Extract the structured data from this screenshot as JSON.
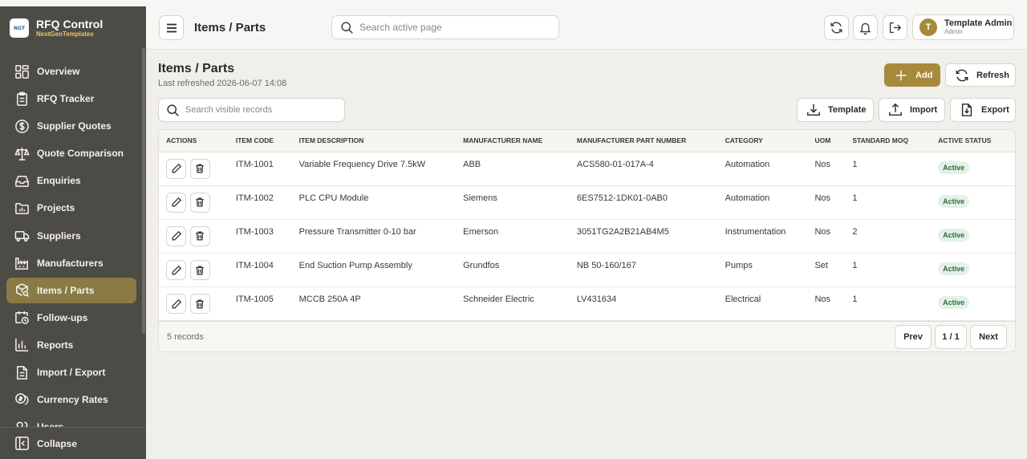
{
  "brand": {
    "title": "RFQ Control",
    "subtitle": "NextGenTemplates",
    "logo_text": "NGT"
  },
  "sidebar": {
    "items": [
      {
        "label": "Overview",
        "icon": "grid-icon"
      },
      {
        "label": "RFQ Tracker",
        "icon": "clipboard-icon"
      },
      {
        "label": "Supplier Quotes",
        "icon": "dollar-circle-icon"
      },
      {
        "label": "Quote Comparison",
        "icon": "scale-icon"
      },
      {
        "label": "Enquiries",
        "icon": "inbox-icon"
      },
      {
        "label": "Projects",
        "icon": "folder-chart-icon"
      },
      {
        "label": "Suppliers",
        "icon": "truck-icon"
      },
      {
        "label": "Manufacturers",
        "icon": "factory-icon"
      },
      {
        "label": "Items / Parts",
        "icon": "box-search-icon",
        "active": true
      },
      {
        "label": "Follow-ups",
        "icon": "calendar-clock-icon"
      },
      {
        "label": "Reports",
        "icon": "bar-chart-icon"
      },
      {
        "label": "Import / Export",
        "icon": "document-icon"
      },
      {
        "label": "Currency Rates",
        "icon": "coins-icon"
      },
      {
        "label": "Users",
        "icon": "users-icon"
      }
    ],
    "collapse_label": "Collapse"
  },
  "header": {
    "title": "Items / Parts",
    "search_placeholder": "Search active page",
    "user": {
      "initial": "T",
      "name": "Template Admin",
      "role": "Admin"
    }
  },
  "main": {
    "title": "Items / Parts",
    "subtitle": "Last refreshed 2026-06-07 14:08",
    "add_label": "Add",
    "refresh_label": "Refresh",
    "template_label": "Template",
    "import_label": "Import",
    "export_label": "Export",
    "search_placeholder": "Search visible records"
  },
  "table": {
    "columns": [
      "Actions",
      "Item Code",
      "Item Description",
      "Manufacturer Name",
      "Manufacturer Part Number",
      "Category",
      "UOM",
      "Standard MOQ",
      "Active Status"
    ],
    "rows": [
      {
        "code": "ITM-1001",
        "desc": "Variable Frequency Drive 7.5kW",
        "mfr": "ABB",
        "mpn": "ACS580-01-017A-4",
        "cat": "Automation",
        "uom": "Nos",
        "moq": "1",
        "status": "Active"
      },
      {
        "code": "ITM-1002",
        "desc": "PLC CPU Module",
        "mfr": "Siemens",
        "mpn": "6ES7512-1DK01-0AB0",
        "cat": "Automation",
        "uom": "Nos",
        "moq": "1",
        "status": "Active"
      },
      {
        "code": "ITM-1003",
        "desc": "Pressure Transmitter 0-10 bar",
        "mfr": "Emerson",
        "mpn": "3051TG2A2B21AB4M5",
        "cat": "Instrumentation",
        "uom": "Nos",
        "moq": "2",
        "status": "Active"
      },
      {
        "code": "ITM-1004",
        "desc": "End Suction Pump Assembly",
        "mfr": "Grundfos",
        "mpn": "NB 50-160/167",
        "cat": "Pumps",
        "uom": "Set",
        "moq": "1",
        "status": "Active"
      },
      {
        "code": "ITM-1005",
        "desc": "MCCB 250A 4P",
        "mfr": "Schneider Electric",
        "mpn": "LV431634",
        "cat": "Electrical",
        "uom": "Nos",
        "moq": "1",
        "status": "Active"
      }
    ],
    "records_text": "5 records",
    "prev_label": "Prev",
    "page_label": "1 / 1",
    "next_label": "Next"
  },
  "colors": {
    "sidebar_bg": "#4d4b46",
    "accent": "#a8893c",
    "active_nav": "#8a7a45",
    "badge_bg": "#e3f1e6",
    "badge_text": "#2e6b3e"
  }
}
